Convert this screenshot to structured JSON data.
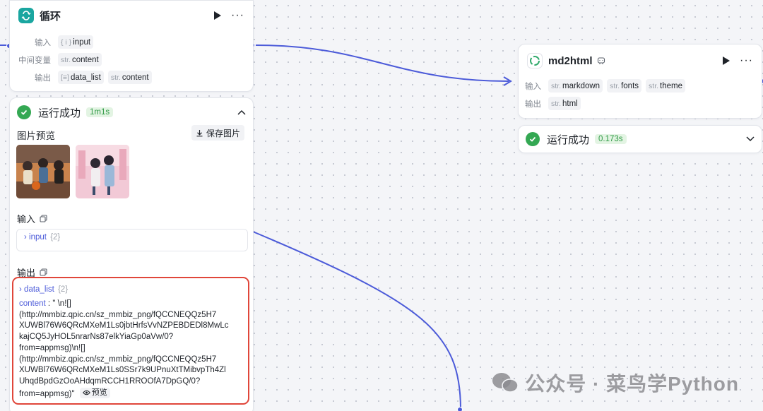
{
  "loop_node": {
    "title": "循环",
    "params": [
      {
        "label": "输入",
        "tags": [
          {
            "type": "{ i }",
            "name": "input"
          }
        ]
      },
      {
        "label": "中间变量",
        "tags": [
          {
            "type": "str.",
            "name": "content"
          }
        ]
      },
      {
        "label": "输出",
        "tags": [
          {
            "type": "[≡]",
            "name": "data_list"
          },
          {
            "type": "str.",
            "name": "content"
          }
        ]
      }
    ]
  },
  "loop_result": {
    "status": "运行成功",
    "time": "1m1s",
    "image_preview_label": "图片预览",
    "save_image_label": "保存图片",
    "input_label": "输入",
    "input_key": "input",
    "input_count": "{2}",
    "output_label": "输出",
    "output_key": "data_list",
    "output_count": "{2}",
    "content_key": "content",
    "content_value": "\" \\n![](http://mmbiz.qpic.cn/sz_mmbiz_png/fQCCNEQQz5H7XUWBl76W6QRcMXeM1Ls0jbtHrfsVvNZPEBDEDl8MwLckajCQ5JyHOL5nrarNs87elkYiaGp0aVw/0?from=appmsg)\\n![](http://mmbiz.qpic.cn/sz_mmbiz_png/fQCCNEQQz5H7XUWBl76W6QRcMXeM1Ls0SSr7k9UPnuXtTMibvpTh4ZlUhqdBpdGzOoAHdqmRCCH1RROOfA7DpGQ/0?from=appmsg)\"",
    "content_lines": [
      "\" \\n![]",
      "(http://mmbiz.qpic.cn/sz_mmbiz_png/fQCCNEQQz5H7",
      "XUWBl76W6QRcMXeM1Ls0jbtHrfsVvNZPEBDEDl8MwLc",
      "kajCQ5JyHOL5nrarNs87elkYiaGp0aVw/0?",
      "from=appmsg)\\n![]",
      "(http://mmbiz.qpic.cn/sz_mmbiz_png/fQCCNEQQz5H7",
      "XUWBl76W6QRcMXeM1Ls0SSr7k9UPnuXtTMibvpTh4Zl",
      "UhqdBpdGzOoAHdqmRCCH1RROOfA7DpGQ/0?",
      "from=appmsg)\""
    ],
    "preview_label": "预览"
  },
  "md_node": {
    "title": "md2html",
    "params": [
      {
        "label": "输入",
        "tags": [
          {
            "type": "str.",
            "name": "markdown"
          },
          {
            "type": "str.",
            "name": "fonts"
          },
          {
            "type": "str.",
            "name": "theme"
          }
        ]
      },
      {
        "label": "输出",
        "tags": [
          {
            "type": "str.",
            "name": "html"
          }
        ]
      }
    ]
  },
  "md_result": {
    "status": "运行成功",
    "time": "0.173s"
  },
  "watermark": "公众号 · 菜鸟学Python",
  "colors": {
    "edge": "#4c5bd9",
    "success": "#34a853",
    "highlight_border": "#e0463a",
    "loop_icon_bg": "#1aa6a0"
  }
}
